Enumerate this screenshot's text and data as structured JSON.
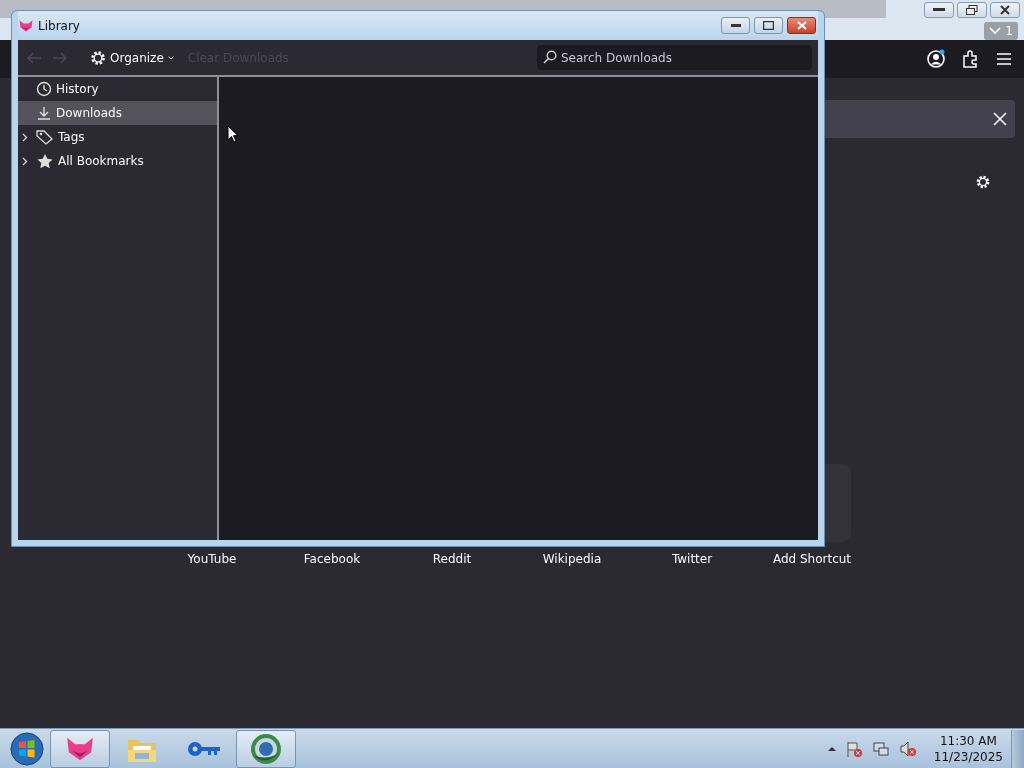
{
  "browser": {
    "tab_counter": "1",
    "shortcuts": [
      {
        "label": "YouTube",
        "kind": "site"
      },
      {
        "label": "Facebook",
        "kind": "site"
      },
      {
        "label": "Reddit",
        "kind": "site"
      },
      {
        "label": "Wikipedia",
        "kind": "site"
      },
      {
        "label": "Twitter",
        "kind": "site"
      },
      {
        "label": "Add Shortcut",
        "kind": "add"
      }
    ]
  },
  "library": {
    "title": "Library",
    "back_disabled": true,
    "forward_disabled": true,
    "organize": "Organize",
    "clear_downloads": {
      "label": "Clear Downloads",
      "disabled": true
    },
    "search": {
      "placeholder": "Search Downloads"
    },
    "sidebar": [
      {
        "label": "History",
        "kind": "clock",
        "expandable": false,
        "selected": false
      },
      {
        "label": "Downloads",
        "kind": "download",
        "expandable": false,
        "selected": true
      },
      {
        "label": "Tags",
        "kind": "tag",
        "expandable": true,
        "selected": false
      },
      {
        "label": "All Bookmarks",
        "kind": "star",
        "expandable": true,
        "selected": false
      }
    ]
  },
  "taskbar": {
    "apps": [
      {
        "kind": "fox",
        "selected": true
      },
      {
        "kind": "folder",
        "selected": false
      },
      {
        "kind": "key",
        "selected": false
      },
      {
        "kind": "globe",
        "selected": true
      }
    ],
    "time": "11:30 AM",
    "date": "11/23/2025"
  }
}
